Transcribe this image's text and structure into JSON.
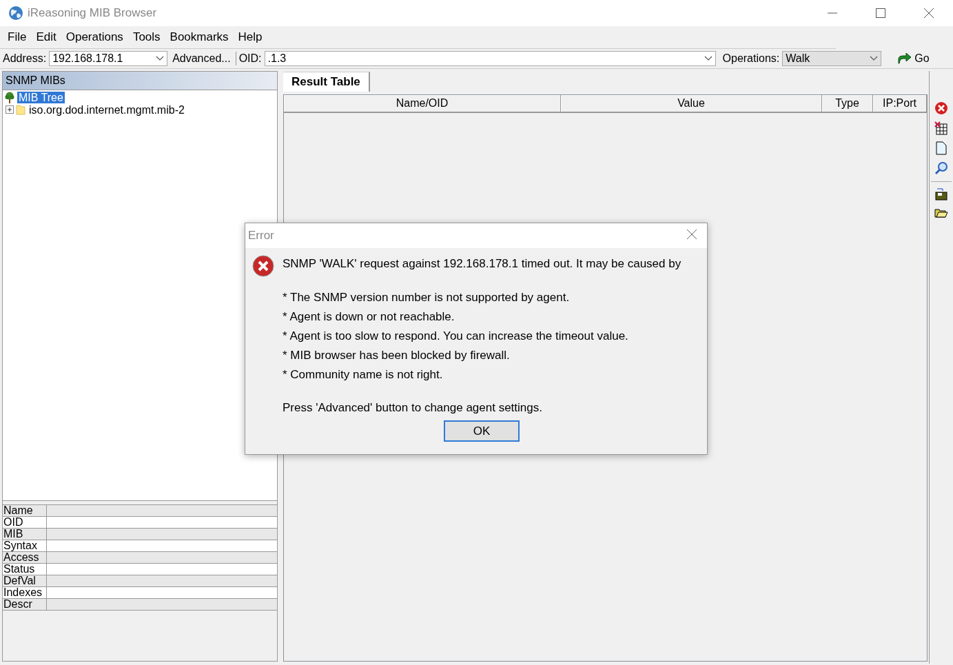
{
  "window": {
    "title": "iReasoning MIB Browser"
  },
  "menu": [
    "File",
    "Edit",
    "Operations",
    "Tools",
    "Bookmarks",
    "Help"
  ],
  "toolbar": {
    "address_label": "Address:",
    "address": "192.168.178.1",
    "advanced_button": "Advanced...",
    "oid_label": "OID:",
    "oid": ".1.3",
    "operations_label": "Operations:",
    "operation": "Walk",
    "go_button": "Go"
  },
  "left_panel": {
    "title": "SNMP MIBs",
    "tree": [
      {
        "label": "MIB Tree",
        "selected": true,
        "children": [
          {
            "label": "iso.org.dod.internet.mgmt.mib-2",
            "selected": false,
            "expanded": false
          }
        ]
      }
    ],
    "properties": [
      "Name",
      "OID",
      "MIB",
      "Syntax",
      "Access",
      "Status",
      "DefVal",
      "Indexes",
      "Descr"
    ]
  },
  "result": {
    "tabs": [
      {
        "label": "Result Table",
        "selected": true
      }
    ],
    "columns": [
      "Name/OID",
      "Value",
      "Type",
      "IP:Port"
    ]
  },
  "dialog": {
    "title": "Error",
    "message": "SNMP 'WALK' request against 192.168.178.1 timed out. It may be caused by",
    "bullets": [
      "* The SNMP version number is not supported by agent.",
      "* Agent is down or not reachable.",
      "* Agent is too slow to respond. You can increase the timeout value.",
      "* MIB browser has been blocked by firewall.",
      "* Community name is not right."
    ],
    "footer": "Press 'Advanced' button to change agent settings.",
    "button": "OK"
  }
}
